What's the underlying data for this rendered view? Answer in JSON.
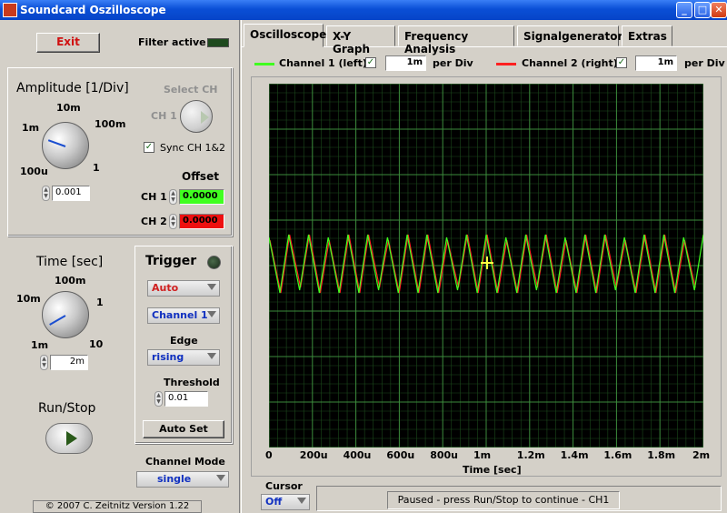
{
  "window": {
    "title": "Soundcard Oszilloscope",
    "minimize": "_",
    "maximize": "□",
    "close": "✕"
  },
  "left": {
    "exit_label": "Exit",
    "filter_label": "Filter active",
    "amplitude": {
      "title": "Amplitude [1/Div]",
      "ticks": [
        "10m",
        "100m",
        "1m",
        "100u",
        "1"
      ],
      "value": "0.001"
    },
    "select_ch": {
      "title": "Select CH",
      "ch_label": "CH 1"
    },
    "sync": {
      "checked": "✓",
      "label": "Sync CH 1&2"
    },
    "offset": {
      "title": "Offset",
      "ch1_label": "CH 1",
      "ch1_value": "0.0000",
      "ch2_label": "CH 2",
      "ch2_value": "0.0000"
    },
    "time": {
      "title": "Time [sec]",
      "ticks": [
        "100m",
        "10m",
        "1",
        "1m",
        "10"
      ],
      "value": "2m"
    },
    "trigger": {
      "title": "Trigger",
      "mode": "Auto",
      "channel": "Channel 1",
      "edge_label": "Edge",
      "edge": "rising",
      "threshold_label": "Threshold",
      "threshold": "0.01",
      "autoset_label": "Auto Set"
    },
    "run_stop_label": "Run/Stop",
    "channel_mode": {
      "label": "Channel Mode",
      "value": "single"
    },
    "copyright": "© 2007  C. Zeitnitz Version 1.22"
  },
  "tabs": [
    {
      "label": "Oscilloscope"
    },
    {
      "label": "X-Y Graph"
    },
    {
      "label": "Frequency Analysis"
    },
    {
      "label": "Signalgenerator"
    },
    {
      "label": "Extras"
    }
  ],
  "channels": {
    "ch1": {
      "label": "Channel 1 (left)",
      "checked": "✓",
      "value": "1m",
      "unit": "per Div",
      "color": "#40ff20"
    },
    "ch2": {
      "label": "Channel 2 (right)",
      "checked": "✓",
      "value": "1m",
      "unit": "per Div",
      "color": "#ff2020"
    }
  },
  "graph": {
    "xticks": [
      "0",
      "200u",
      "400u",
      "600u",
      "800u",
      "1m",
      "1.2m",
      "1.4m",
      "1.6m",
      "1.8m",
      "2m"
    ],
    "xlabel": "Time [sec]"
  },
  "cursor": {
    "label": "Cursor",
    "value": "Off"
  },
  "status": "Paused - press Run/Stop to continue - CH1"
}
